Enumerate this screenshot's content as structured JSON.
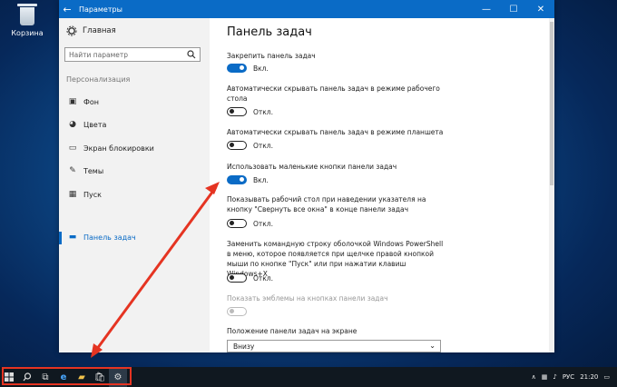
{
  "desktop": {
    "recycle_bin_label": "Корзина"
  },
  "window": {
    "title": "Параметры",
    "back_icon": "←",
    "min_icon": "—",
    "max_icon": "☐",
    "close_icon": "✕"
  },
  "sidebar": {
    "home_label": "Главная",
    "search_placeholder": "Найти параметр",
    "section_label": "Персонализация",
    "items": [
      {
        "label": "Фон",
        "icon": "image-icon"
      },
      {
        "label": "Цвета",
        "icon": "palette-icon"
      },
      {
        "label": "Экран блокировки",
        "icon": "monitor-icon"
      },
      {
        "label": "Темы",
        "icon": "brush-icon"
      },
      {
        "label": "Пуск",
        "icon": "start-icon"
      },
      {
        "label": "Панель задач",
        "icon": "taskbar-icon",
        "active": true
      }
    ]
  },
  "content": {
    "title": "Панель задач",
    "settings": [
      {
        "label": "Закрепить панель задач",
        "state": "Вкл."
      },
      {
        "label": "Автоматически скрывать панель задач в режиме рабочего стола",
        "state": "Откл."
      },
      {
        "label": "Автоматически скрывать панель задач в режиме планшета",
        "state": "Откл."
      },
      {
        "label": "Использовать маленькие кнопки панели задач",
        "state": "Вкл."
      },
      {
        "label": "Показывать рабочий стол при наведении указателя на кнопку \"Свернуть все окна\" в конце панели задач",
        "state": "Откл."
      },
      {
        "label": "Заменить командную строку оболочкой Windows PowerShell в меню, которое появляется при щелчке правой кнопкой мыши по кнопке \"Пуск\" или при нажатии клавиш Windows+X",
        "state": "Откл."
      },
      {
        "label": "Показать эмблемы на кнопках панели задач",
        "state": ""
      }
    ],
    "position_label": "Положение панели задач на экране",
    "position_value": "Внизу"
  },
  "taskbar": {
    "language": "РУС",
    "time": "21:20"
  },
  "colors": {
    "accent": "#0a6bc6",
    "annotation": "#e53422"
  }
}
